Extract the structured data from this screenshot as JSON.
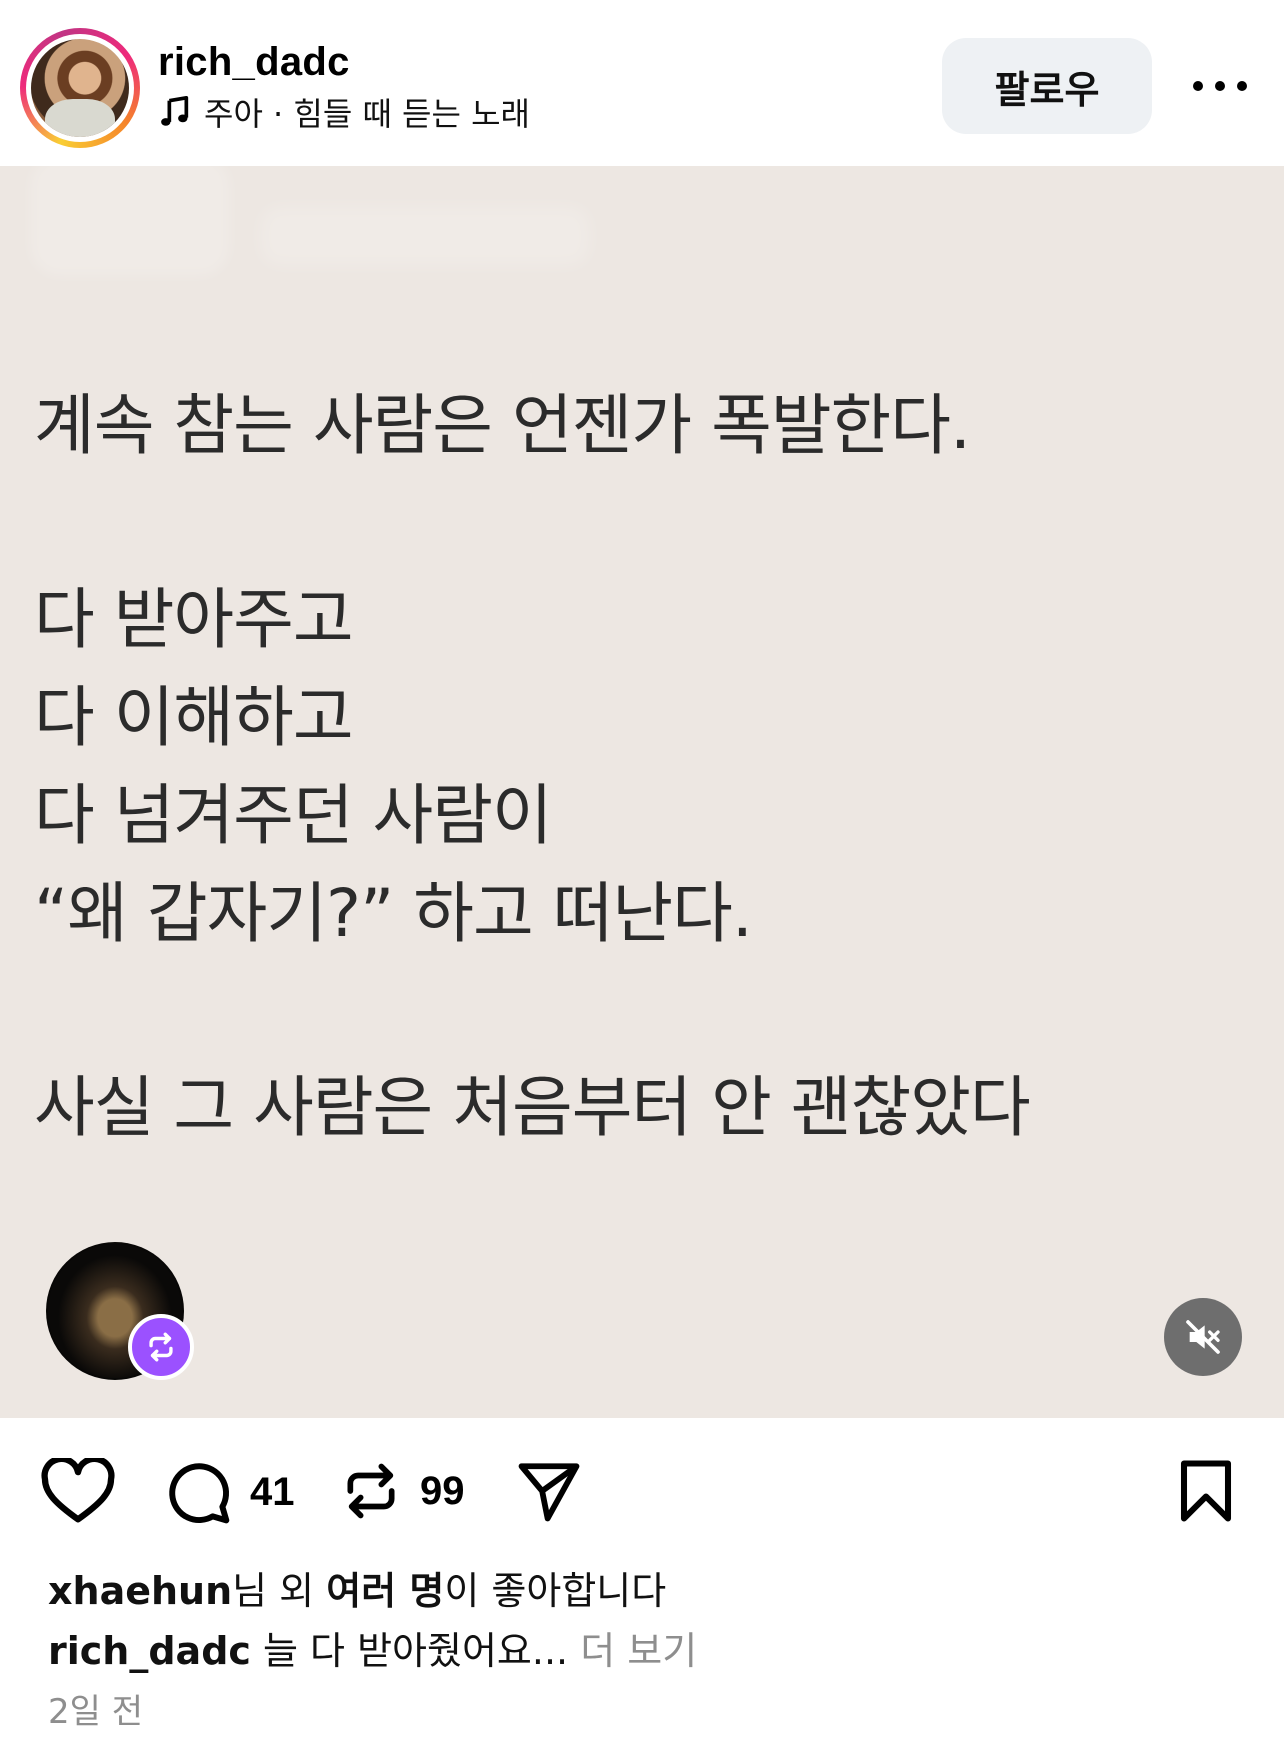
{
  "header": {
    "username": "rich_dadc",
    "music": "주아 · 힘들 때 듣는 노래",
    "follow_label": "팔로우"
  },
  "post": {
    "lines": [
      "계속 참는 사람은 언젠가 폭발한다.",
      "다 받아주고",
      "다 이해하고",
      "다 넘겨주던 사람이",
      "“왜 갑자기?” 하고 떠난다.",
      "사실 그 사람은 처음부터 안 괜찮았다"
    ]
  },
  "actions": {
    "comment_count": "41",
    "repost_count": "99"
  },
  "likes": {
    "user": "xhaehun",
    "mid": "님 외 ",
    "bold": "여러 명",
    "tail": "이 좋아합니다"
  },
  "caption": {
    "username": "rich_dadc",
    "text": " 늘 다 받아줬어요...",
    "more": " 더 보기"
  },
  "timestamp": "2일 전"
}
